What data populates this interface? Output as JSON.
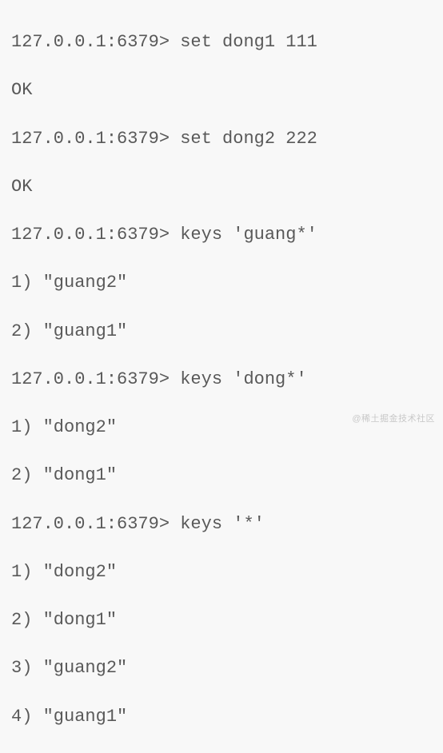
{
  "terminal": {
    "lines": [
      "127.0.0.1:6379> set dong1 111",
      "OK",
      "127.0.0.1:6379> set dong2 222",
      "OK",
      "127.0.0.1:6379> keys 'guang*'",
      "1) \"guang2\"",
      "2) \"guang1\"",
      "127.0.0.1:6379> keys 'dong*'",
      "1) \"dong2\"",
      "2) \"dong1\"",
      "127.0.0.1:6379> keys '*'",
      "1) \"dong2\"",
      "2) \"dong1\"",
      "3) \"guang2\"",
      "4) \"guang1\""
    ]
  },
  "watermark": "@稀土掘金技术社区"
}
